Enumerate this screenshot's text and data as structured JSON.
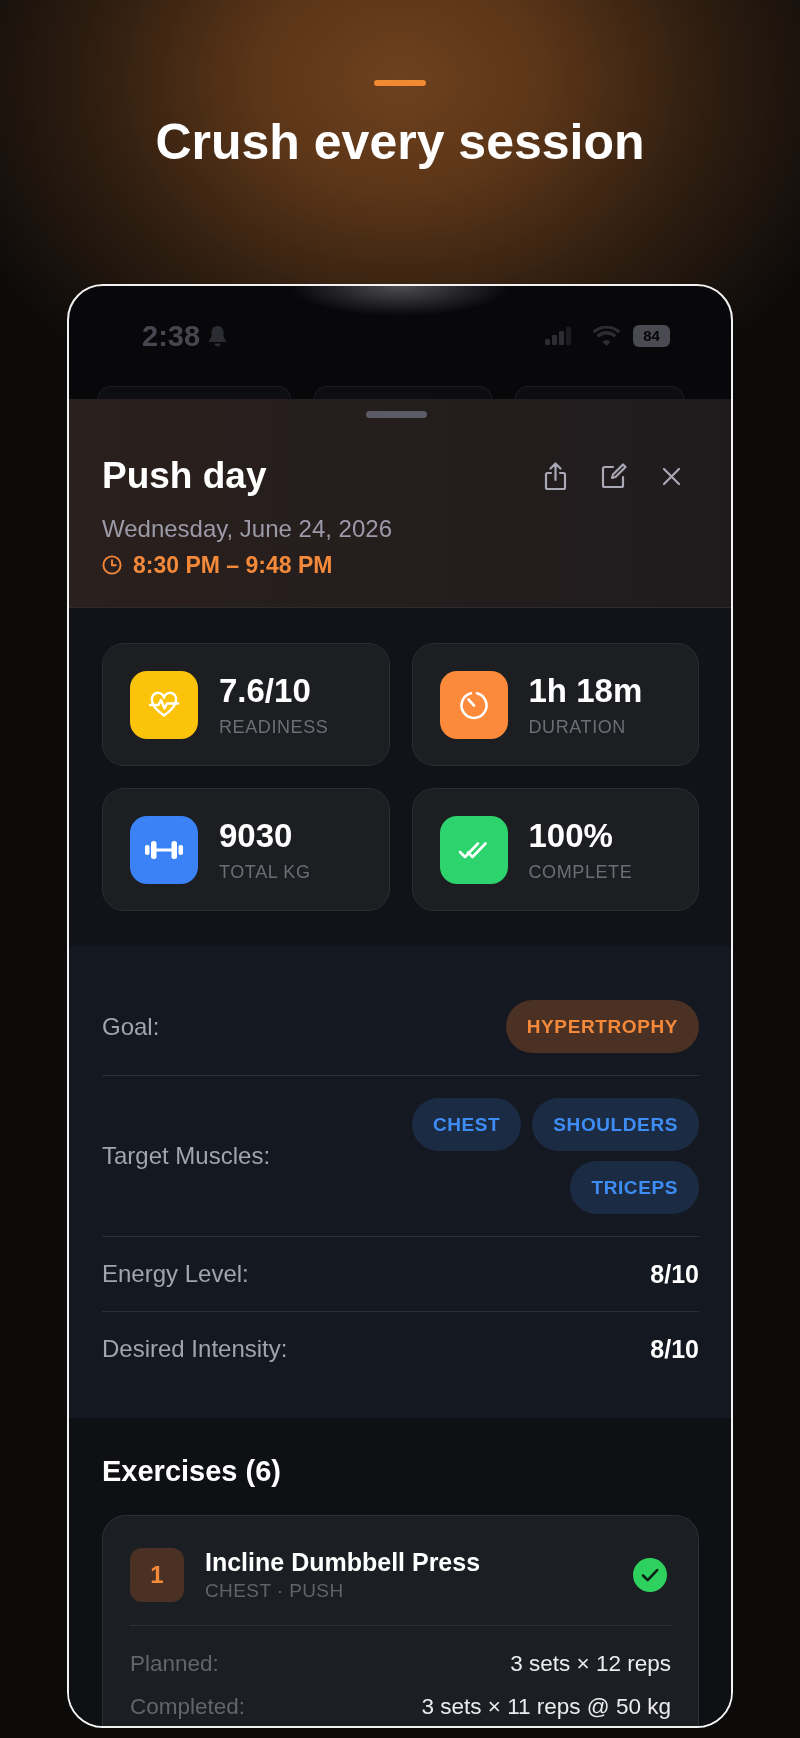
{
  "promo": {
    "headline": "Crush every session"
  },
  "status_bar": {
    "time": "2:38",
    "battery": "84"
  },
  "session": {
    "title": "Push day",
    "date": "Wednesday, June 24, 2026",
    "time_range": "8:30 PM – 9:48 PM"
  },
  "stats": [
    {
      "kind": "readiness",
      "value": "7.6/10",
      "label": "READINESS",
      "color": "#fcc30b"
    },
    {
      "kind": "duration",
      "value": "1h 18m",
      "label": "DURATION",
      "color": "#fd8a3a"
    },
    {
      "kind": "volume",
      "value": "9030",
      "label": "TOTAL KG",
      "color": "#3b82f6"
    },
    {
      "kind": "completion",
      "value": "100%",
      "label": "COMPLETE",
      "color": "#2dd46d"
    }
  ],
  "details": [
    {
      "kind": "goal",
      "label": "Goal:",
      "tags": [
        "HYPERTROPHY"
      ]
    },
    {
      "kind": "muscles",
      "label": "Target Muscles:",
      "tags": [
        "CHEST",
        "SHOULDERS",
        "TRICEPS"
      ]
    },
    {
      "kind": "value",
      "label": "Energy Level:",
      "value": "8/10"
    },
    {
      "kind": "value",
      "label": "Desired Intensity:",
      "value": "8/10"
    }
  ],
  "exercises": {
    "title": "Exercises (6)",
    "items": [
      {
        "number": "1",
        "name": "Incline Dumbbell Press",
        "category": "CHEST · PUSH",
        "completed": true,
        "sets": [
          {
            "label": "Planned:",
            "value": "3 sets × 12 reps"
          },
          {
            "label": "Completed:",
            "value": "3 sets × 11 reps @ 50 kg"
          }
        ]
      }
    ]
  }
}
